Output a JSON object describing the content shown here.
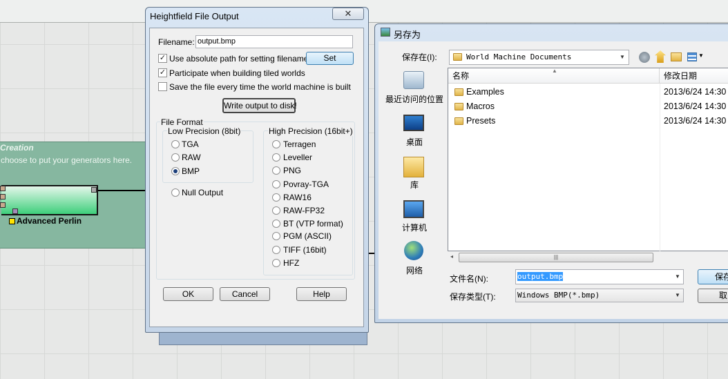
{
  "canvas": {
    "group_title": "Creation",
    "group_subtitle": "choose to put your generators here.",
    "node_label": "Advanced Perlin"
  },
  "heightfield_dialog": {
    "title": "Heightfield File Output",
    "close_glyph": "✕",
    "filename_label": "Filename:",
    "filename_value": "output.bmp",
    "options": [
      {
        "label": "Use absolute path for setting filename",
        "checked": true
      },
      {
        "label": "Participate when building tiled worlds",
        "checked": true
      },
      {
        "label": "Save the file every time the world machine is built",
        "checked": false
      }
    ],
    "set_button": "Set",
    "write_button": "Write output to disk!",
    "file_format_label": "File Format",
    "low_precision_label": "Low Precision (8bit)",
    "low_precision_options": [
      {
        "label": "TGA",
        "selected": false
      },
      {
        "label": "RAW",
        "selected": false
      },
      {
        "label": "BMP",
        "selected": true
      }
    ],
    "null_output_label": "Null Output",
    "high_precision_label": "High Precision (16bit+)",
    "high_precision_options": [
      {
        "label": "Terragen"
      },
      {
        "label": "Leveller"
      },
      {
        "label": "PNG"
      },
      {
        "label": "Povray-TGA"
      },
      {
        "label": "RAW16"
      },
      {
        "label": "RAW-FP32"
      },
      {
        "label": "BT (VTP format)"
      },
      {
        "label": "PGM (ASCII)"
      },
      {
        "label": "TIFF (16bit)"
      },
      {
        "label": "HFZ"
      }
    ],
    "ok_button": "OK",
    "cancel_button": "Cancel",
    "help_button": "Help"
  },
  "save_dialog": {
    "title": "另存为",
    "save_in_label": "保存在(I):",
    "save_in_value": "World Machine Documents",
    "places": [
      {
        "label": "最近访问的位置",
        "icon": "recent-places-icon"
      },
      {
        "label": "桌面",
        "icon": "desktop-icon"
      },
      {
        "label": "库",
        "icon": "libraries-icon"
      },
      {
        "label": "计算机",
        "icon": "computer-icon"
      },
      {
        "label": "网络",
        "icon": "network-icon"
      }
    ],
    "columns": {
      "name": "名称",
      "modified": "修改日期"
    },
    "files": [
      {
        "name": "Examples",
        "date": "2013/6/24 14:30"
      },
      {
        "name": "Macros",
        "date": "2013/6/24 14:30"
      },
      {
        "name": "Presets",
        "date": "2013/6/24 14:30"
      }
    ],
    "filename_label": "文件名(N):",
    "filename_value": "output.bmp",
    "filetype_label": "保存类型(T):",
    "filetype_value": "Windows BMP(*.bmp)",
    "save_button": "保存",
    "cancel_button": "取"
  },
  "colors": {
    "group_fill": "#86b7a0",
    "node_gradient_end": "#3ecf7b",
    "selection": "#3399ff"
  }
}
